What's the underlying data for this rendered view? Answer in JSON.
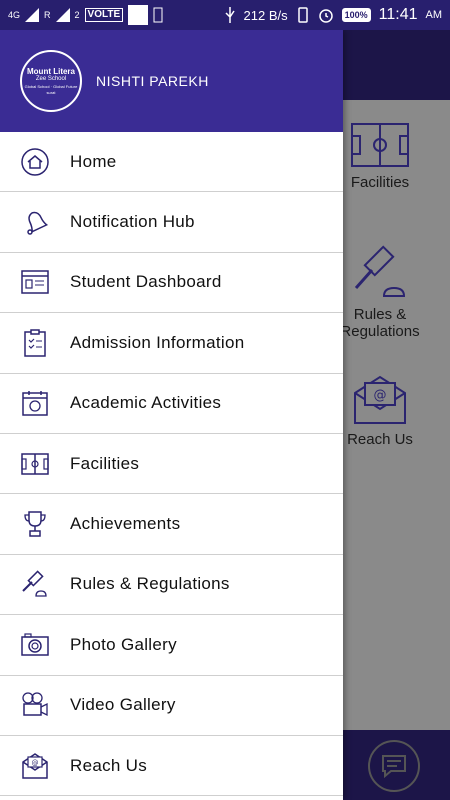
{
  "status_bar": {
    "network": "4G",
    "roaming": "R",
    "sim2": "2",
    "volte": "VOLTE",
    "speed": "212 B/s",
    "battery": "100%",
    "time": "11:41",
    "ampm": "AM"
  },
  "drawer": {
    "logo": {
      "line1": "Mount Litera",
      "line2": "Zee School",
      "line3": "Global School · Global Future",
      "line4": "surat"
    },
    "user_name": "NISHTI PAREKH",
    "items": [
      {
        "label": "Home",
        "icon": "home-icon"
      },
      {
        "label": "Notification Hub",
        "icon": "bell-icon"
      },
      {
        "label": "Student Dashboard",
        "icon": "dashboard-icon"
      },
      {
        "label": "Admission Information",
        "icon": "clipboard-icon"
      },
      {
        "label": "Academic Activities",
        "icon": "calendar-ball-icon"
      },
      {
        "label": "Facilities",
        "icon": "football-field-icon"
      },
      {
        "label": "Achievements",
        "icon": "trophy-icon"
      },
      {
        "label": "Rules & Regulations",
        "icon": "gavel-icon"
      },
      {
        "label": "Photo Gallery",
        "icon": "camera-icon"
      },
      {
        "label": "Video Gallery",
        "icon": "video-camera-icon"
      },
      {
        "label": "Reach Us",
        "icon": "mail-icon"
      }
    ]
  },
  "background": {
    "tiles": [
      {
        "label": "Facilities",
        "label2": ""
      },
      {
        "label": "Rules &",
        "label2": "Regulations"
      },
      {
        "label": "Reach Us",
        "label2": ""
      }
    ]
  },
  "colors": {
    "header": "#3a2c94",
    "statusbar": "#281f6e",
    "icon": "#2b2470"
  }
}
